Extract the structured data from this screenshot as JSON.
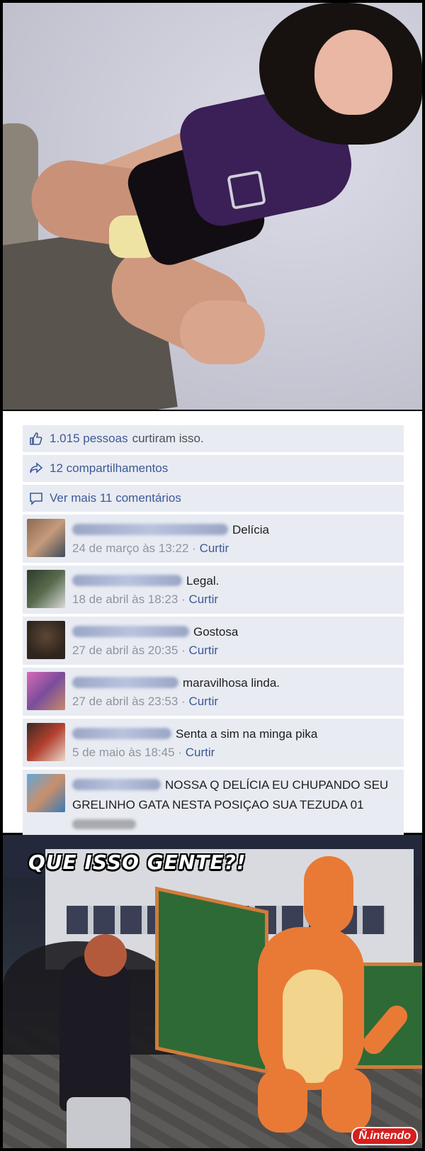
{
  "facebook": {
    "likes_text": "1.015 pessoas",
    "likes_suffix": "curtiram isso.",
    "shares_text": "12 compartilhamentos",
    "more_comments_text": "Ver mais 11 comentários",
    "like_action": "Curtir",
    "comments": [
      {
        "text": "Delícia",
        "timestamp": "24 de março às 13:22"
      },
      {
        "text": "Legal.",
        "timestamp": "18 de abril às 18:23"
      },
      {
        "text": "Gostosa",
        "timestamp": "27 de abril às 20:35"
      },
      {
        "text": "maravilhosa linda.",
        "timestamp": "27 de abril às 23:53"
      },
      {
        "text": "Senta a sim na minga pika",
        "timestamp": "5 de maio às 18:45"
      },
      {
        "text": "NOSSA Q DELÍCIA EU CHUPANDO SEU GRELINHO GATA NESTA POSIÇAO SUA TEZUDA 01"
      }
    ]
  },
  "meme": {
    "caption": "QUE ISSO GENTE?!",
    "logo": "Ñ.intendo"
  },
  "colors": {
    "fb_link": "#3b5998",
    "fb_row_bg": "#e9ebf2",
    "logo_red": "#d81e1e"
  }
}
